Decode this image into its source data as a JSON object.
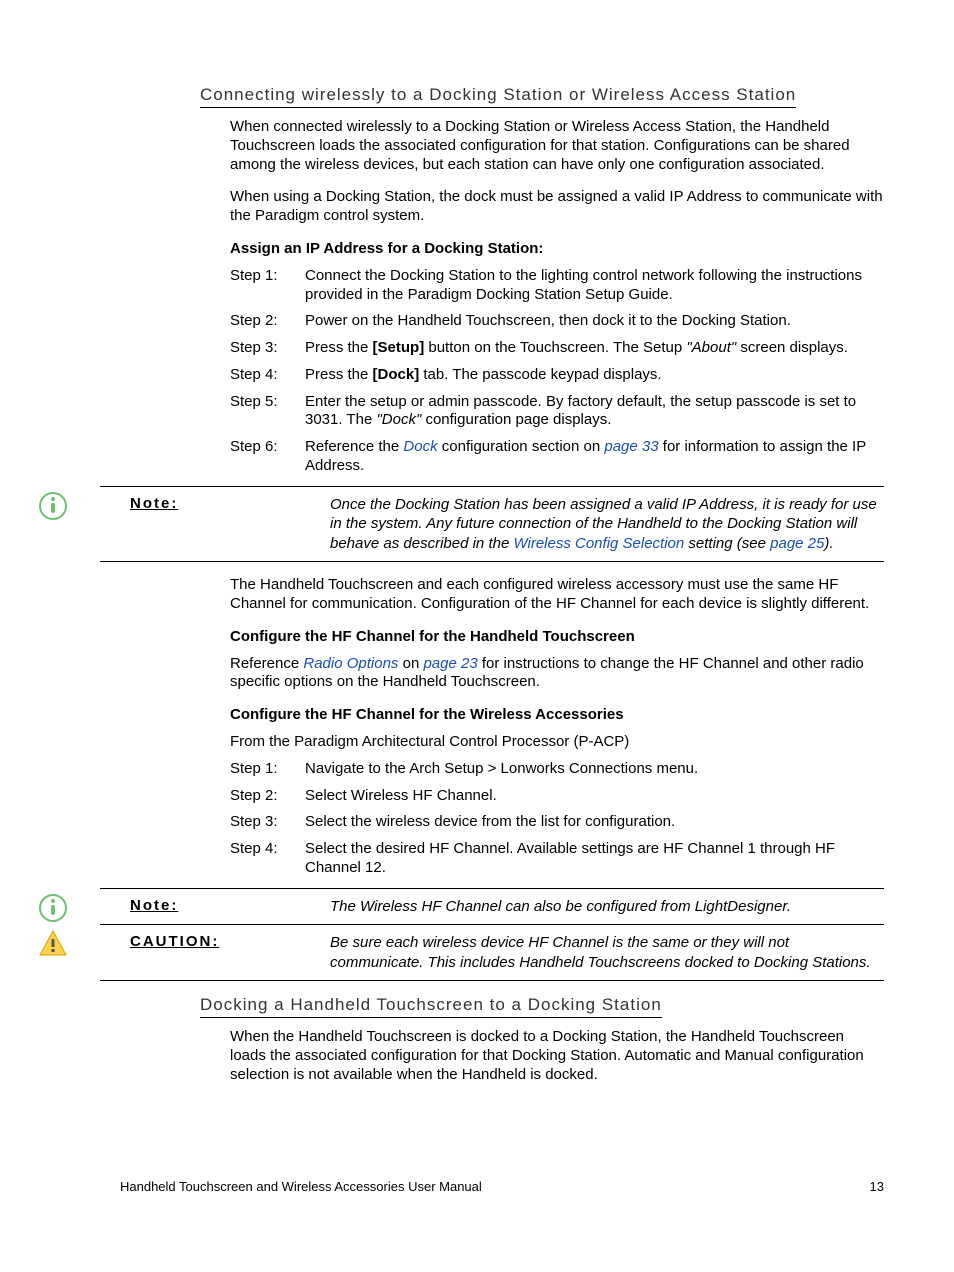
{
  "section1": {
    "heading": "Connecting wirelessly to a Docking Station or Wireless Access Station",
    "para1": "When connected wirelessly to a Docking Station or Wireless Access Station, the Handheld Touchscreen loads the associated configuration for that station. Configurations can be shared among the wireless devices, but each station can have only one configuration associated.",
    "para2": "When using a Docking Station, the dock must be assigned a valid IP Address to communicate with the Paradigm control system.",
    "subhead1": "Assign an IP Address for a Docking Station:",
    "steps1": [
      {
        "label": "Step 1:",
        "text_a": "Connect the Docking Station to the lighting control network following the instructions provided in the Paradigm Docking Station Setup Guide."
      },
      {
        "label": "Step 2:",
        "text_a": "Power on the Handheld Touchscreen, then dock it to the Docking Station."
      },
      {
        "label": "Step 3:",
        "pre": "Press the ",
        "bold": "[Setup]",
        "mid": " button on the Touchscreen. The Setup ",
        "ital": "\"About\"",
        "post": " screen displays."
      },
      {
        "label": "Step 4:",
        "pre": "Press the ",
        "bold": "[Dock]",
        "post": " tab. The passcode keypad displays."
      },
      {
        "label": "Step 5:",
        "pre": "Enter the setup or admin passcode. By factory default, the setup passcode is set to 3031. The ",
        "ital": "\"Dock\"",
        "post": " configuration page displays."
      },
      {
        "label": "Step 6:",
        "pre": "Reference the ",
        "link1": "Dock",
        "mid": " configuration section on ",
        "link2": "page 33",
        "post": " for information to assign the IP Address."
      }
    ],
    "note1": {
      "label": "Note:",
      "pre": "Once the Docking Station has been assigned a valid IP Address, it is ready for use in the system. Any future connection of the Handheld to the Docking Station will behave as described in the ",
      "link1": "Wireless Config Selection",
      "mid": " setting (see ",
      "link2": "page 25",
      "post": ")."
    },
    "para3": "The Handheld Touchscreen and each configured wireless accessory must use the same HF Channel for communication. Configuration of the HF Channel for each device is slightly different.",
    "subhead2": "Configure the HF Channel for the Handheld Touchscreen",
    "para4": {
      "pre": "Reference ",
      "link1": "Radio Options",
      "mid": " on ",
      "link2": "page 23",
      "post": " for instructions to change the HF Channel and other radio specific options on the Handheld Touchscreen."
    },
    "subhead3": "Configure the HF Channel for the Wireless Accessories",
    "para5": "From the Paradigm Architectural Control Processor (P-ACP)",
    "steps2": [
      {
        "label": "Step 1:",
        "text_a": "Navigate to the Arch Setup > Lonworks Connections menu."
      },
      {
        "label": "Step 2:",
        "text_a": "Select Wireless HF Channel."
      },
      {
        "label": "Step 3:",
        "text_a": "Select the wireless device from the list for configuration."
      },
      {
        "label": "Step 4:",
        "text_a": "Select the desired HF Channel. Available settings are HF Channel 1 through HF Channel 12."
      }
    ],
    "note2": {
      "label": "Note:",
      "text": "The Wireless HF Channel can also be configured from LightDesigner."
    },
    "caution": {
      "label": "CAUTION:",
      "text": "Be sure each wireless device HF Channel is the same or they will not communicate. This includes Handheld Touchscreens docked to Docking Stations."
    }
  },
  "section2": {
    "heading": "Docking a Handheld Touchscreen to a Docking Station",
    "para1": "When the Handheld Touchscreen is docked to a Docking Station, the Handheld Touchscreen loads the associated configuration for that Docking Station. Automatic and Manual configuration selection is not available when the Handheld is docked."
  },
  "footer": {
    "title": "Handheld Touchscreen and Wireless Accessories User Manual",
    "page": "13"
  }
}
